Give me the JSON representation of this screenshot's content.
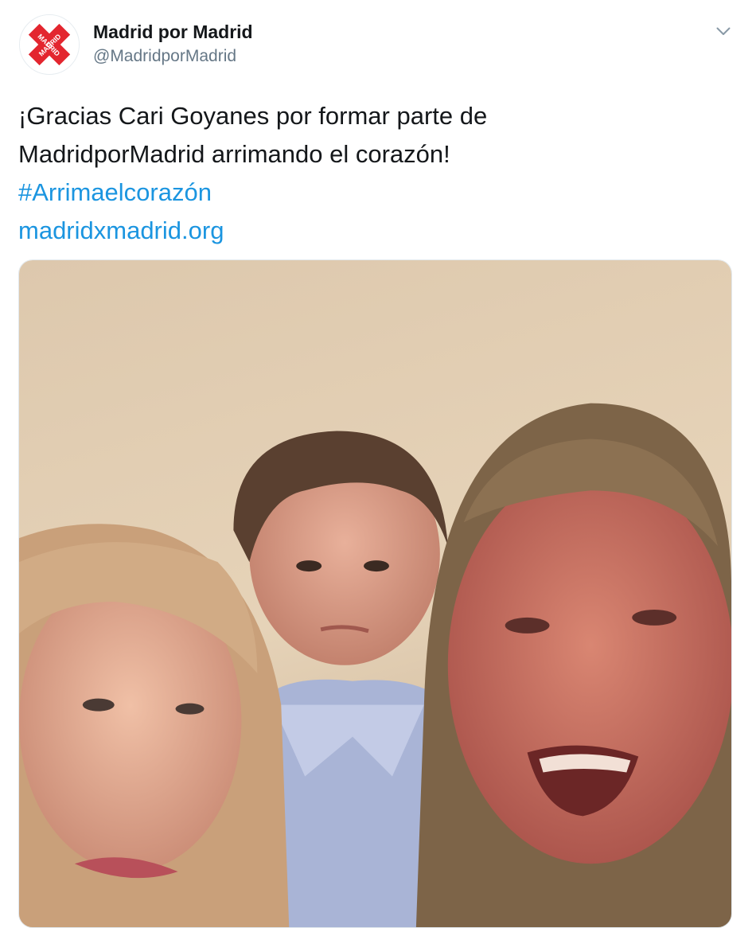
{
  "author": {
    "display_name": "Madrid por Madrid",
    "handle": "@MadridporMadrid",
    "avatar_logo_text": "MADRID",
    "avatar_color": "#e3262f"
  },
  "tweet": {
    "text_line_1": "¡Gracias Cari Goyanes por formar parte de",
    "text_line_2": "MadridporMadrid arrimando el corazón!",
    "hashtag": "#Arrimaelcorazón",
    "link": "madridxmadrid.org",
    "link_color": "#1b95e0"
  },
  "icons": {
    "menu": "chevron-down-icon"
  },
  "media": {
    "type": "video-still"
  }
}
